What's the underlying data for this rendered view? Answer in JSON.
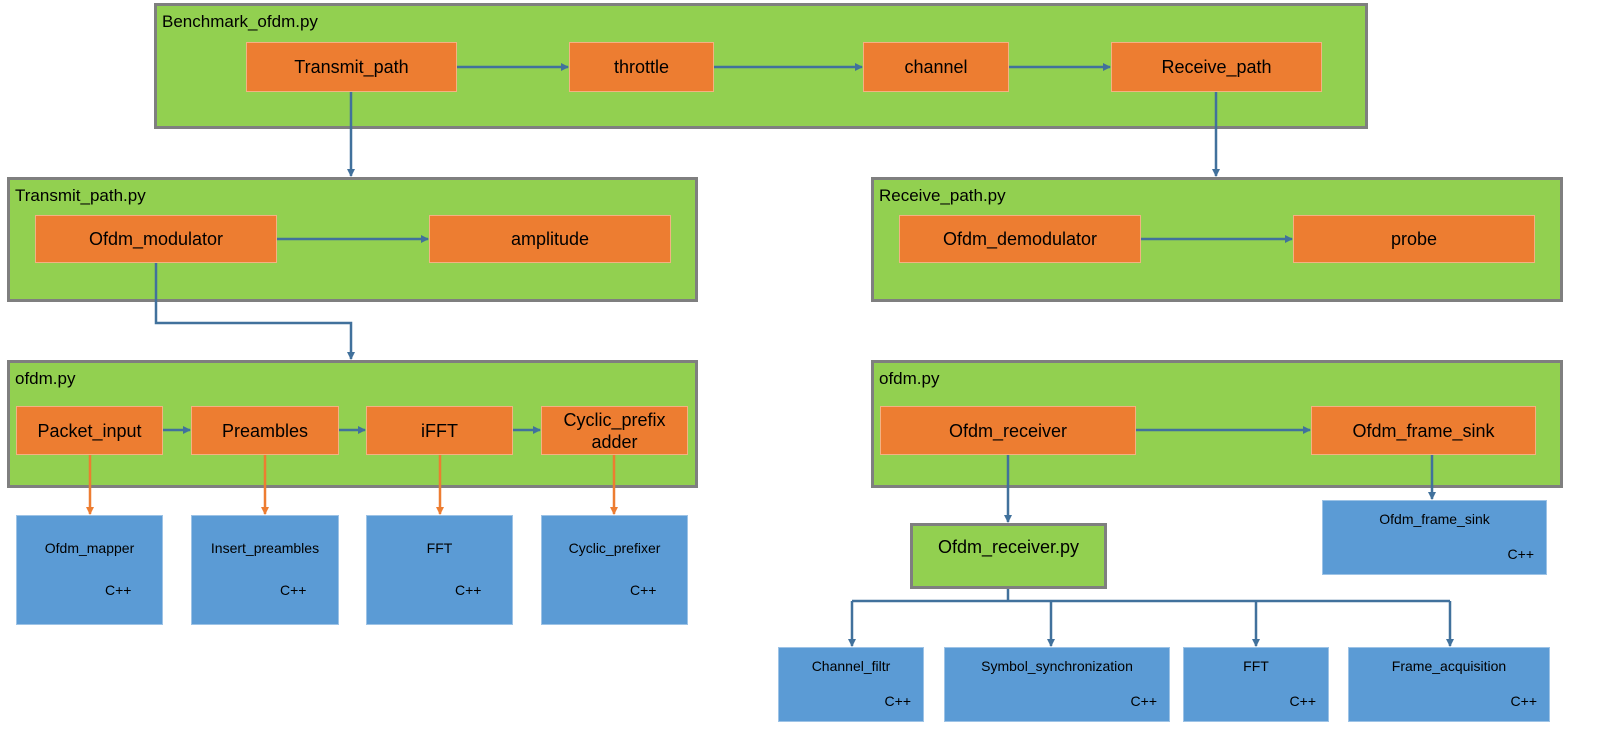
{
  "colors": {
    "container": "#92d050",
    "block": "#ed7d31",
    "library": "#5b9bd5",
    "border": "#7f7f7f",
    "arrow": "#41719c",
    "orange_arrow": "#ed7d31"
  },
  "benchmark": {
    "title": "Benchmark_ofdm.py",
    "blocks": [
      "Transmit_path",
      "throttle",
      "channel",
      "Receive_path"
    ]
  },
  "transmit_path": {
    "title": "Transmit_path.py",
    "blocks": [
      "Ofdm_modulator",
      "amplitude"
    ]
  },
  "receive_path": {
    "title": "Receive_path.py",
    "blocks": [
      "Ofdm_demodulator",
      "probe"
    ]
  },
  "ofdm_tx": {
    "title": "ofdm.py",
    "blocks": [
      "Packet_input",
      "Preambles",
      "iFFT",
      "Cyclic_prefix adder"
    ]
  },
  "ofdm_rx": {
    "title": "ofdm.py",
    "blocks": [
      "Ofdm_receiver",
      "Ofdm_frame_sink"
    ]
  },
  "ofdm_receiver_py": {
    "title": "Ofdm_receiver.py"
  },
  "tx_libs": [
    {
      "name": "Ofdm_mapper",
      "lang": "C++"
    },
    {
      "name": "Insert_preambles",
      "lang": "C++"
    },
    {
      "name": "FFT",
      "lang": "C++"
    },
    {
      "name": "Cyclic_prefixer",
      "lang": "C++"
    }
  ],
  "sink_lib": {
    "name": "Ofdm_frame_sink",
    "lang": "C++"
  },
  "rx_libs": [
    {
      "name": "Channel_filtr",
      "lang": "C++"
    },
    {
      "name": "Symbol_synchronization",
      "lang": "C++"
    },
    {
      "name": "FFT",
      "lang": "C++"
    },
    {
      "name": "Frame_acquisition",
      "lang": "C++"
    }
  ]
}
